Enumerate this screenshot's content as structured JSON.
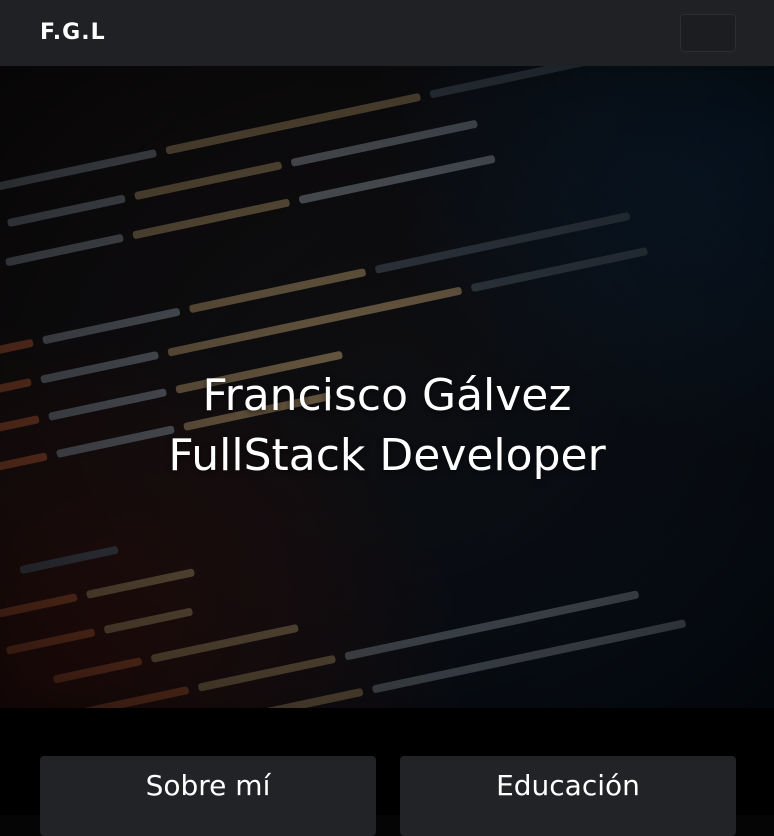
{
  "navbar": {
    "brand": "F.G.L"
  },
  "hero": {
    "title_line1": "Francisco Gálvez",
    "title_line2": "FullStack Developer"
  },
  "cards": {
    "about_label": "Sobre mí",
    "education_label": "Educación"
  }
}
